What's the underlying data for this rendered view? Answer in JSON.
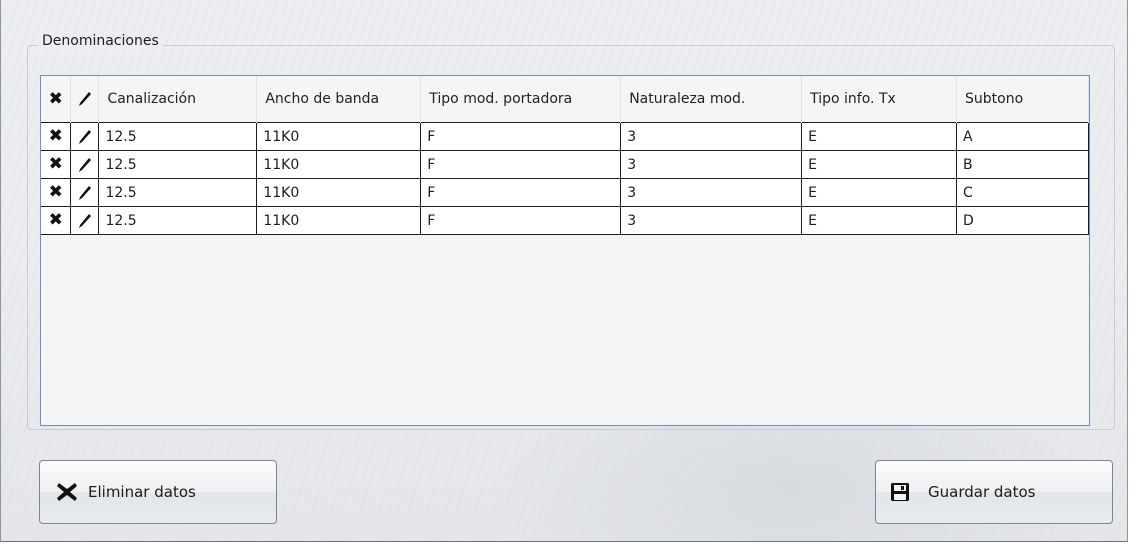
{
  "group_title": "Denominaciones",
  "columns": [
    "Canalización",
    "Ancho de banda",
    "Tipo mod. portadora",
    "Naturaleza mod.",
    "Tipo info. Tx",
    "Subtono"
  ],
  "rows": [
    {
      "canalizacion": "12.5",
      "ancho_banda": "11K0",
      "tipo_mod": "F",
      "naturaleza": "3",
      "tipo_info": "E",
      "subtono": "A"
    },
    {
      "canalizacion": "12.5",
      "ancho_banda": "11K0",
      "tipo_mod": "F",
      "naturaleza": "3",
      "tipo_info": "E",
      "subtono": "B"
    },
    {
      "canalizacion": "12.5",
      "ancho_banda": "11K0",
      "tipo_mod": "F",
      "naturaleza": "3",
      "tipo_info": "E",
      "subtono": "C"
    },
    {
      "canalizacion": "12.5",
      "ancho_banda": "11K0",
      "tipo_mod": "F",
      "naturaleza": "3",
      "tipo_info": "E",
      "subtono": "D"
    }
  ],
  "icons": {
    "delete": "close-x-icon",
    "edit": "pencil-icon",
    "save": "floppy-disk-icon"
  },
  "buttons": {
    "delete_label": "Eliminar datos",
    "save_label": "Guardar datos"
  },
  "colors": {
    "grid_border": "#6f8fb8",
    "button_border": "#7e8590",
    "background": "#eceef2"
  }
}
